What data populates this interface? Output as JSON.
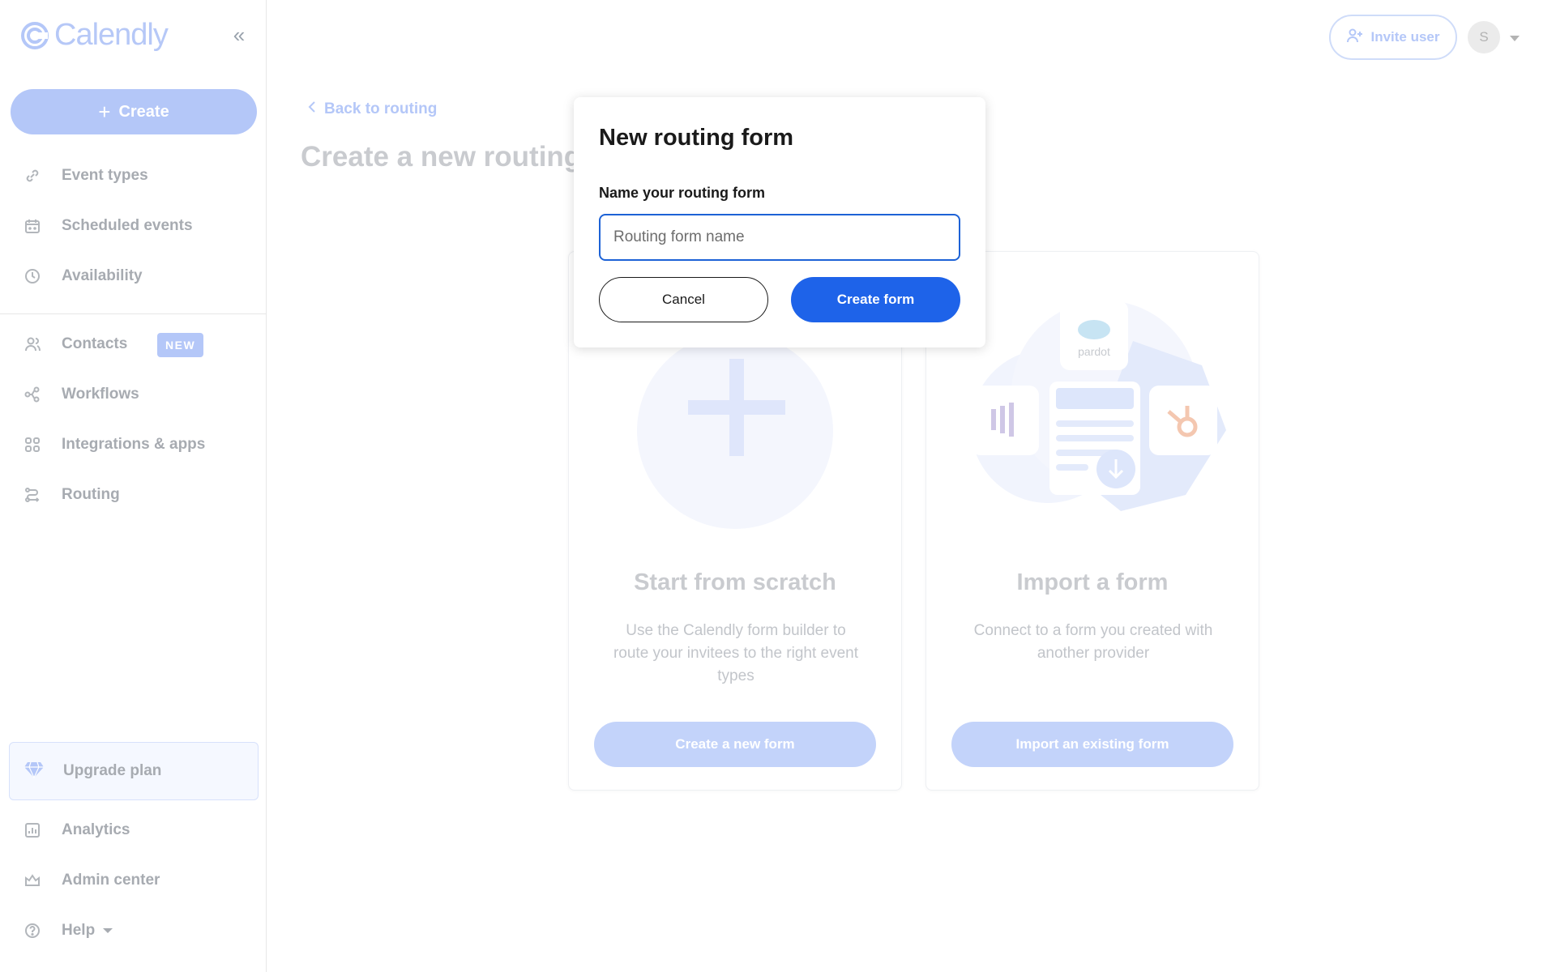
{
  "brand": {
    "name": "Calendly",
    "accent": "#1e63e9",
    "accent_light": "#b4c7f8"
  },
  "sidebar": {
    "create_label": "Create",
    "items": [
      {
        "label": "Event types",
        "icon": "link-icon"
      },
      {
        "label": "Scheduled events",
        "icon": "calendar-icon"
      },
      {
        "label": "Availability",
        "icon": "clock-icon"
      },
      {
        "label": "Contacts",
        "icon": "contacts-icon",
        "badge": "NEW"
      },
      {
        "label": "Workflows",
        "icon": "workflow-icon"
      },
      {
        "label": "Integrations & apps",
        "icon": "apps-grid-icon"
      },
      {
        "label": "Routing",
        "icon": "routing-icon"
      }
    ],
    "upgrade_label": "Upgrade plan",
    "bottom_items": [
      {
        "label": "Analytics",
        "icon": "analytics-icon"
      },
      {
        "label": "Admin center",
        "icon": "crown-icon"
      },
      {
        "label": "Help",
        "icon": "help-icon"
      }
    ]
  },
  "header": {
    "invite_label": "Invite user",
    "avatar_initial": "S"
  },
  "main": {
    "back_link": "Back to routing",
    "page_title": "Create a new routing",
    "cards": [
      {
        "title": "Start from scratch",
        "description": "Use the Calendly form builder to route your invitees to the right event types",
        "button": "Create a new form"
      },
      {
        "title": "Import a form",
        "description": "Connect to a form you created with another provider",
        "button": "Import an existing form",
        "integration_logos": [
          "salesforce",
          "pardot"
        ]
      }
    ]
  },
  "modal": {
    "title": "New routing form",
    "field_label": "Name your routing form",
    "input_value": "",
    "input_placeholder": "Routing form name",
    "cancel_label": "Cancel",
    "submit_label": "Create form"
  }
}
